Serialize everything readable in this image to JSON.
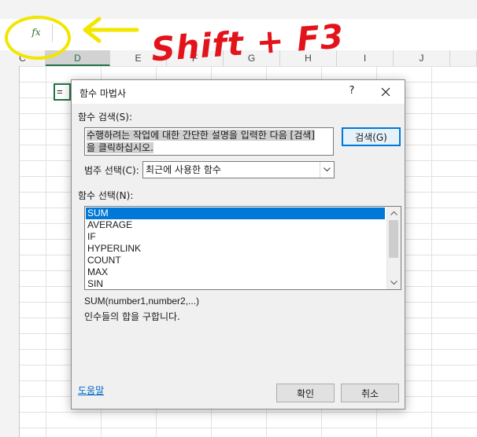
{
  "excel": {
    "fx_label": "fx",
    "columns": [
      "C",
      "D",
      "E",
      "F",
      "G",
      "H",
      "I",
      "J"
    ],
    "active_column": "D",
    "active_cell_value": "="
  },
  "annotation": {
    "text": "Shift + F3",
    "text_color": "#e3131b",
    "circle_color": "#f2e600",
    "arrow_color": "#f2e600"
  },
  "dialog": {
    "title": "함수 마법사",
    "help_label": "?",
    "search_label": "함수 검색(S):",
    "search_value_line1": "수행하려는 작업에 대한 간단한 설명을 입력한 다음 [검색]",
    "search_value_line2": "을 클릭하십시오.",
    "search_button": "검색(G)",
    "category_label": "범주 선택(C):",
    "category_value": "최근에 사용한 함수",
    "function_list_label": "함수 선택(N):",
    "functions": [
      "SUM",
      "AVERAGE",
      "IF",
      "HYPERLINK",
      "COUNT",
      "MAX",
      "SIN"
    ],
    "selected_function": "SUM",
    "syntax": "SUM(number1,number2,...)",
    "description": "인수들의 합을 구합니다.",
    "help_link": "도움말",
    "ok_button": "확인",
    "cancel_button": "취소",
    "accent_color": "#0078d7"
  }
}
